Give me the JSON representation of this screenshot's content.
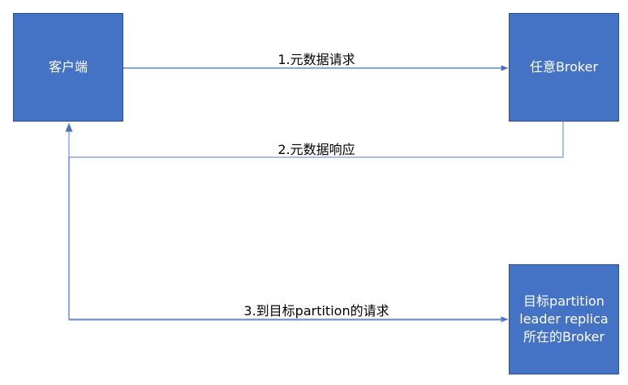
{
  "nodes": {
    "client": "客户端",
    "any_broker": "任意Broker",
    "leader_broker": [
      "目标partition",
      "leader replica",
      "所在的Broker"
    ]
  },
  "edges": {
    "metadata_request": "1.元数据请求",
    "metadata_response": "2.元数据响应",
    "partition_request": "3.到目标partition的请求"
  },
  "colors": {
    "box_fill": "#4472C4",
    "box_border": "#2F528F",
    "line": "#4472C4",
    "line_light": "#8FAADC"
  }
}
